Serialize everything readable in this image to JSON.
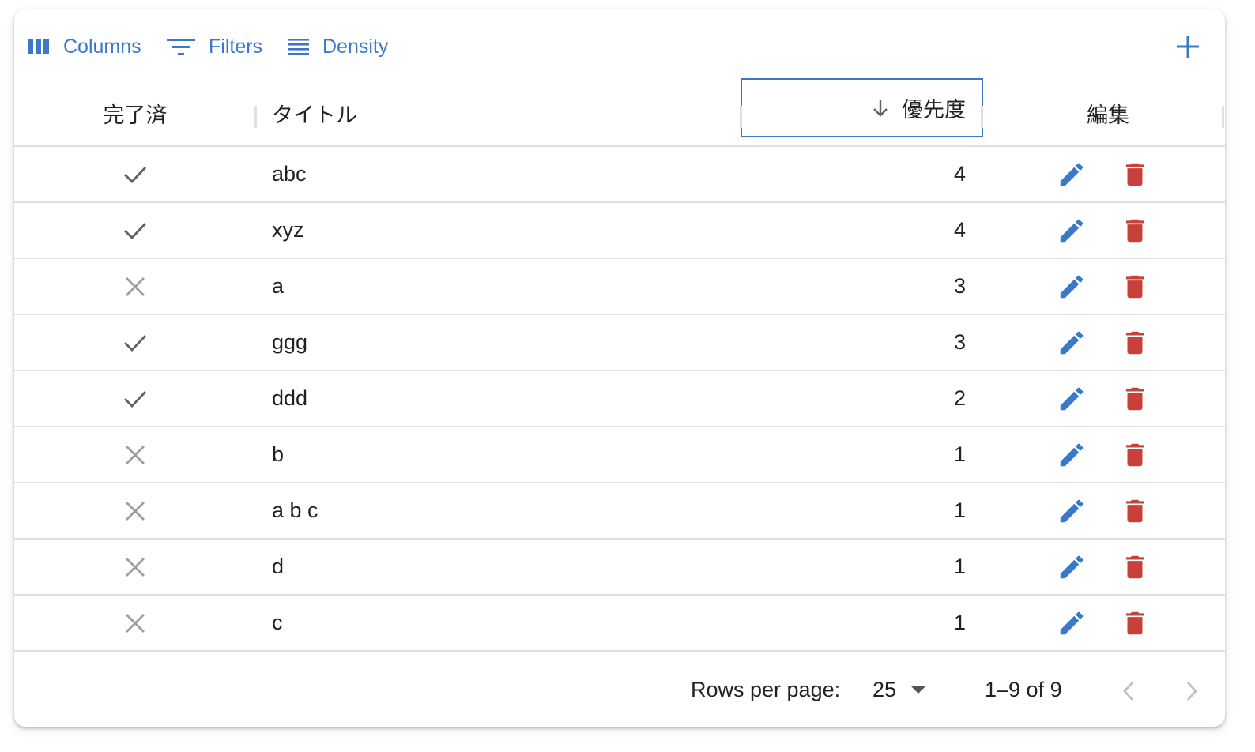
{
  "toolbar": {
    "columns_label": "Columns",
    "filters_label": "Filters",
    "density_label": "Density",
    "add_icon": "plus-icon"
  },
  "columns": {
    "done": "完了済",
    "title": "タイトル",
    "priority": "優先度",
    "edit": "編集",
    "priority_sort": "descending"
  },
  "rows": [
    {
      "done": true,
      "title": "abc",
      "priority": "4"
    },
    {
      "done": true,
      "title": "xyz",
      "priority": "4"
    },
    {
      "done": false,
      "title": "a",
      "priority": "3"
    },
    {
      "done": true,
      "title": "ggg",
      "priority": "3"
    },
    {
      "done": true,
      "title": "ddd",
      "priority": "2"
    },
    {
      "done": false,
      "title": "b",
      "priority": "1"
    },
    {
      "done": false,
      "title": "a b c",
      "priority": "1"
    },
    {
      "done": false,
      "title": "d",
      "priority": "1"
    },
    {
      "done": false,
      "title": "c",
      "priority": "1"
    }
  ],
  "footer": {
    "rows_per_page_label": "Rows per page:",
    "rows_per_page_value": "25",
    "range": "1–9 of 9"
  },
  "colors": {
    "accent": "#3a78cc",
    "delete": "#c8403a",
    "check": "#616161",
    "cross": "#9e9e9e"
  }
}
